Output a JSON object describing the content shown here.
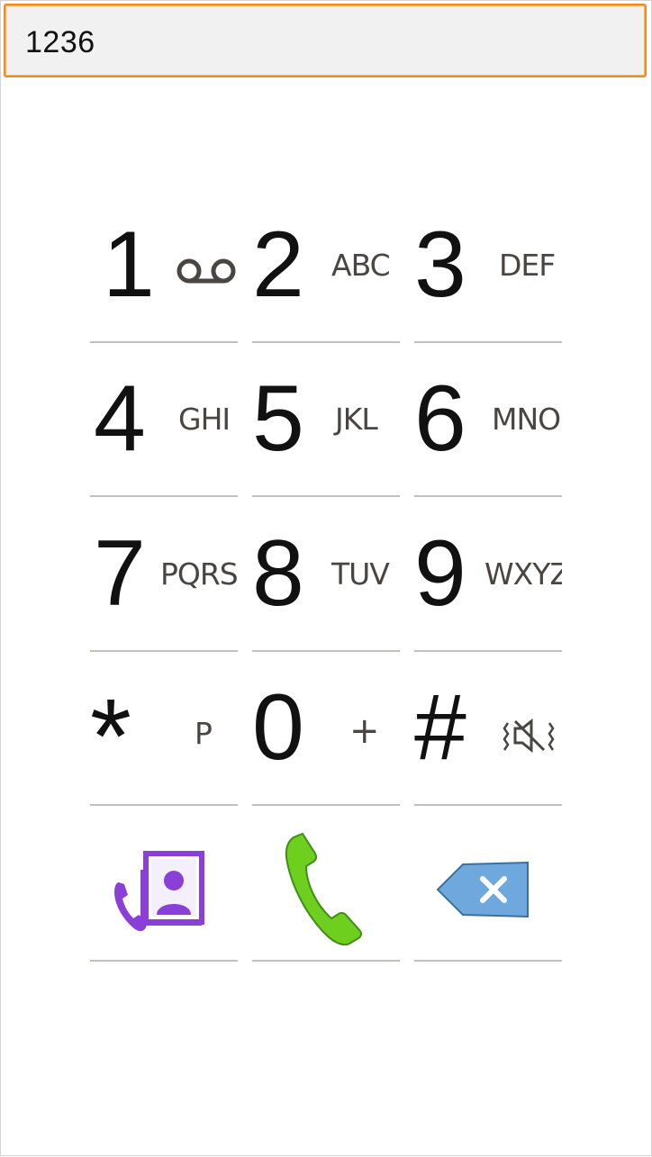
{
  "display": {
    "value": "1236"
  },
  "keys": [
    {
      "digit": "1",
      "letters": "",
      "sub_icon": "voicemail-icon"
    },
    {
      "digit": "2",
      "letters": "ABC"
    },
    {
      "digit": "3",
      "letters": "DEF"
    },
    {
      "digit": "4",
      "letters": "GHI"
    },
    {
      "digit": "5",
      "letters": "JKL"
    },
    {
      "digit": "6",
      "letters": "MNO"
    },
    {
      "digit": "7",
      "letters": "PQRS"
    },
    {
      "digit": "8",
      "letters": "TUV"
    },
    {
      "digit": "9",
      "letters": "WXYZ"
    },
    {
      "digit": "*",
      "letters": "P"
    },
    {
      "digit": "0",
      "letters": "+"
    },
    {
      "digit": "#",
      "letters": "",
      "sub_icon": "vibrate-mute-icon"
    }
  ],
  "actions": [
    {
      "name": "contacts",
      "icon": "contacts-icon",
      "color": "#8b3fd9"
    },
    {
      "name": "call",
      "icon": "phone-icon",
      "color": "#6fcf1f"
    },
    {
      "name": "backspace",
      "icon": "backspace-icon",
      "color": "#6fa8dc"
    }
  ],
  "colors": {
    "field_border": "#f4891f",
    "field_bg": "#f1f1f1",
    "divider": "#c2bfbc",
    "text": "#111111",
    "letters": "#4a4540"
  }
}
